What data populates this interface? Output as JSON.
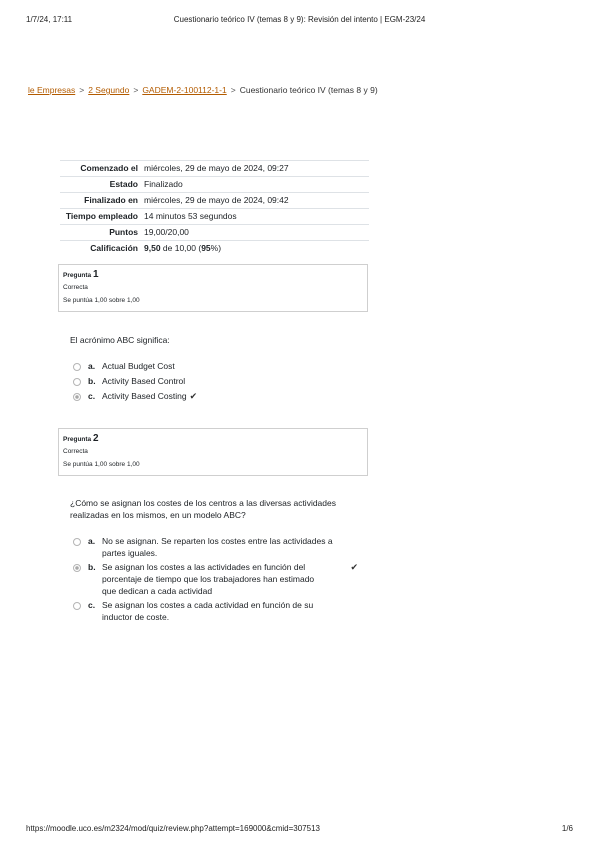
{
  "print_header": {
    "date": "1/7/24, 17:11",
    "title": "Cuestionario teórico IV (temas 8 y 9): Revisión del intento | EGM-23/24"
  },
  "breadcrumb": [
    {
      "label": "le Empresas",
      "link": true
    },
    {
      "label": "2 Segundo",
      "link": true
    },
    {
      "label": "GADEM-2-100112-1-1",
      "link": true
    },
    {
      "label": "Cuestionario teórico IV (temas 8 y 9)",
      "link": false
    }
  ],
  "breadcrumb_separator": ">",
  "summary": [
    {
      "label": "Comenzado el",
      "value": "miércoles, 29 de mayo de 2024, 09:27"
    },
    {
      "label": "Estado",
      "value": "Finalizado"
    },
    {
      "label": "Finalizado en",
      "value": "miércoles, 29 de mayo de 2024, 09:42"
    },
    {
      "label": "Tiempo empleado",
      "value": "14 minutos 53 segundos"
    },
    {
      "label": "Puntos",
      "value": "19,00/20,00"
    },
    {
      "label": "Calificación",
      "value_bold": "9,50",
      "value_mid": " de 10,00 (",
      "value_pct": "95",
      "value_end": "%)"
    }
  ],
  "questions": [
    {
      "prefix": "Pregunta",
      "number": "1",
      "state": "Correcta",
      "grade": "Se puntúa 1,00 sobre 1,00",
      "text": "El acrónimo ABC significa:",
      "answers": [
        {
          "letter": "a.",
          "text": "Actual Budget Cost",
          "selected": false,
          "correct_mark": false
        },
        {
          "letter": "b.",
          "text": "Activity Based Control",
          "selected": false,
          "correct_mark": false
        },
        {
          "letter": "c.",
          "text": "Activity Based Costing",
          "selected": true,
          "correct_mark": true
        }
      ]
    },
    {
      "prefix": "Pregunta",
      "number": "2",
      "state": "Correcta",
      "grade": "Se puntúa 1,00 sobre 1,00",
      "text": "¿Cómo se asignan los costes de los centros a las diversas actividades realizadas en los mismos, en un modelo ABC?",
      "answers": [
        {
          "letter": "a.",
          "text": "No se asignan. Se reparten los costes entre las actividades a partes iguales.",
          "selected": false,
          "correct_mark": false
        },
        {
          "letter": "b.",
          "text": "Se asignan los costes a las actividades en función del porcentaje de tiempo que los trabajadores han estimado que dedican a cada actividad",
          "selected": true,
          "correct_mark": true
        },
        {
          "letter": "c.",
          "text": "Se asignan los costes a cada actividad en función de su inductor de coste.",
          "selected": false,
          "correct_mark": false
        }
      ]
    }
  ],
  "correct_icon": "check-icon",
  "correct_glyph": "✔",
  "print_footer": {
    "url": "https://moodle.uco.es/m2324/mod/quiz/review.php?attempt=169000&cmid=307513",
    "page": "1/6"
  }
}
